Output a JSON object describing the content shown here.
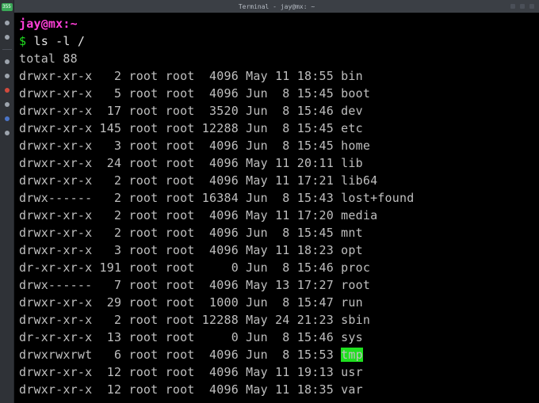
{
  "window": {
    "title": "Terminal - jay@mx: ~"
  },
  "dock": {
    "badge": "355"
  },
  "prompt": {
    "user_host": "jay@mx",
    "path": "~",
    "sep1": ":",
    "dollar": "$",
    "command": "ls -l /"
  },
  "total": "total 88",
  "rows": [
    {
      "perm": "drwxr-xr-x",
      "links": "2",
      "owner": "root",
      "group": "root",
      "size": "4096",
      "month": "May",
      "day": "11",
      "time": "18:55",
      "name": "bin",
      "class": "c-dir"
    },
    {
      "perm": "drwxr-xr-x",
      "links": "5",
      "owner": "root",
      "group": "root",
      "size": "4096",
      "month": "Jun",
      "day": "8",
      "time": "15:45",
      "name": "boot",
      "class": "c-dir"
    },
    {
      "perm": "drwxr-xr-x",
      "links": "17",
      "owner": "root",
      "group": "root",
      "size": "3520",
      "month": "Jun",
      "day": "8",
      "time": "15:46",
      "name": "dev",
      "class": "c-dir"
    },
    {
      "perm": "drwxr-xr-x",
      "links": "145",
      "owner": "root",
      "group": "root",
      "size": "12288",
      "month": "Jun",
      "day": "8",
      "time": "15:45",
      "name": "etc",
      "class": "c-dir"
    },
    {
      "perm": "drwxr-xr-x",
      "links": "3",
      "owner": "root",
      "group": "root",
      "size": "4096",
      "month": "Jun",
      "day": "8",
      "time": "15:45",
      "name": "home",
      "class": "c-dir"
    },
    {
      "perm": "drwxr-xr-x",
      "links": "24",
      "owner": "root",
      "group": "root",
      "size": "4096",
      "month": "May",
      "day": "11",
      "time": "20:11",
      "name": "lib",
      "class": "c-dir"
    },
    {
      "perm": "drwxr-xr-x",
      "links": "2",
      "owner": "root",
      "group": "root",
      "size": "4096",
      "month": "May",
      "day": "11",
      "time": "17:21",
      "name": "lib64",
      "class": "c-dir"
    },
    {
      "perm": "drwx------",
      "links": "2",
      "owner": "root",
      "group": "root",
      "size": "16384",
      "month": "Jun",
      "day": "8",
      "time": "15:43",
      "name": "lost+found",
      "class": "c-dir"
    },
    {
      "perm": "drwxr-xr-x",
      "links": "2",
      "owner": "root",
      "group": "root",
      "size": "4096",
      "month": "May",
      "day": "11",
      "time": "17:20",
      "name": "media",
      "class": "c-dir"
    },
    {
      "perm": "drwxr-xr-x",
      "links": "2",
      "owner": "root",
      "group": "root",
      "size": "4096",
      "month": "Jun",
      "day": "8",
      "time": "15:45",
      "name": "mnt",
      "class": "c-dir"
    },
    {
      "perm": "drwxr-xr-x",
      "links": "3",
      "owner": "root",
      "group": "root",
      "size": "4096",
      "month": "May",
      "day": "11",
      "time": "18:23",
      "name": "opt",
      "class": "c-dir"
    },
    {
      "perm": "dr-xr-xr-x",
      "links": "191",
      "owner": "root",
      "group": "root",
      "size": "0",
      "month": "Jun",
      "day": "8",
      "time": "15:46",
      "name": "proc",
      "class": "c-dir"
    },
    {
      "perm": "drwx------",
      "links": "7",
      "owner": "root",
      "group": "root",
      "size": "4096",
      "month": "May",
      "day": "13",
      "time": "17:27",
      "name": "root",
      "class": "c-dir"
    },
    {
      "perm": "drwxr-xr-x",
      "links": "29",
      "owner": "root",
      "group": "root",
      "size": "1000",
      "month": "Jun",
      "day": "8",
      "time": "15:47",
      "name": "run",
      "class": "c-dir"
    },
    {
      "perm": "drwxr-xr-x",
      "links": "2",
      "owner": "root",
      "group": "root",
      "size": "12288",
      "month": "May",
      "day": "24",
      "time": "21:23",
      "name": "sbin",
      "class": "c-dir"
    },
    {
      "perm": "dr-xr-xr-x",
      "links": "13",
      "owner": "root",
      "group": "root",
      "size": "0",
      "month": "Jun",
      "day": "8",
      "time": "15:46",
      "name": "sys",
      "class": "c-dir"
    },
    {
      "perm": "drwxrwxrwt",
      "links": "6",
      "owner": "root",
      "group": "root",
      "size": "4096",
      "month": "Jun",
      "day": "8",
      "time": "15:53",
      "name": "tmp",
      "class": "c-sticky"
    },
    {
      "perm": "drwxr-xr-x",
      "links": "12",
      "owner": "root",
      "group": "root",
      "size": "4096",
      "month": "May",
      "day": "11",
      "time": "19:13",
      "name": "usr",
      "class": "c-dir"
    },
    {
      "perm": "drwxr-xr-x",
      "links": "12",
      "owner": "root",
      "group": "root",
      "size": "4096",
      "month": "May",
      "day": "11",
      "time": "18:35",
      "name": "var",
      "class": "c-dir"
    }
  ]
}
